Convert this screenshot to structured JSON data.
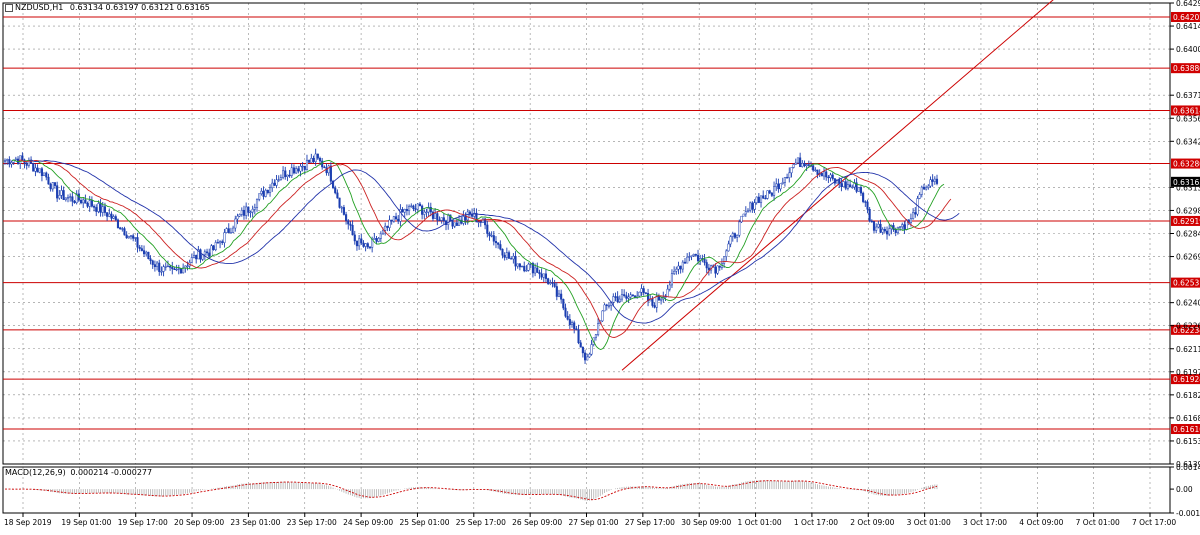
{
  "chart_header": {
    "symbol_info": "NZDUSD,H1",
    "ohlc": "0.63134 0.63197 0.63121 0.63165"
  },
  "macd_header": {
    "label": "MACD(12,26,9)",
    "values": "0.000214 -0.000277"
  },
  "colors": {
    "background": "#ffffff",
    "grid": "#000000",
    "candle": "#1a3db0",
    "level_line": "#cc0000",
    "level_label_bg": "#d00000",
    "current_price_bg": "#000000",
    "ma_fast": "#22a022",
    "ma_mid": "#cc2222",
    "ma_slow": "#2233aa",
    "trend_line": "#cc0000",
    "macd_hist": "#b0b0b0",
    "macd_signal": "#cc0000"
  },
  "chart_data": {
    "type": "candlestick",
    "symbol": "NZDUSD",
    "timeframe": "H1",
    "price_axis_ticks": [
      "0.64290",
      "0.64145",
      "0.64000",
      "0.63710",
      "0.63565",
      "0.63420",
      "0.63130",
      "0.62985",
      "0.62840",
      "0.62695",
      "0.62405",
      "0.62260",
      "0.62115",
      "0.61970",
      "0.61825",
      "0.61680",
      "0.61535",
      "0.61390"
    ],
    "price_range": [
      0.6139,
      0.6429
    ],
    "time_labels": [
      "18 Sep 2019",
      "19 Sep 01:00",
      "19 Sep 17:00",
      "20 Sep 09:00",
      "23 Sep 01:00",
      "23 Sep 17:00",
      "24 Sep 09:00",
      "25 Sep 01:00",
      "25 Sep 17:00",
      "26 Sep 09:00",
      "27 Sep 01:00",
      "27 Sep 17:00",
      "30 Sep 09:00",
      "1 Oct 01:00",
      "1 Oct 17:00",
      "2 Oct 09:00",
      "3 Oct 01:00",
      "3 Oct 17:00",
      "4 Oct 09:00",
      "7 Oct 01:00",
      "7 Oct 17:00"
    ],
    "horizontal_levels": [
      "0.64202",
      "0.63880",
      "0.63614",
      "0.63280",
      "0.62919",
      "0.62531",
      "0.62234",
      "0.61924",
      "0.61610"
    ],
    "current_price": "0.63165",
    "price_path": [
      0.633,
      0.6331,
      0.6327,
      0.6322,
      0.6309,
      0.6306,
      0.6305,
      0.6301,
      0.6296,
      0.6288,
      0.6279,
      0.6269,
      0.6262,
      0.6259,
      0.6265,
      0.6271,
      0.6273,
      0.6283,
      0.6294,
      0.6301,
      0.631,
      0.6319,
      0.6324,
      0.6327,
      0.6331,
      0.6324,
      0.63,
      0.628,
      0.6274,
      0.6282,
      0.6292,
      0.6299,
      0.63,
      0.6296,
      0.6293,
      0.6291,
      0.6296,
      0.629,
      0.6278,
      0.6268,
      0.6264,
      0.6262,
      0.6254,
      0.624,
      0.6223,
      0.6203,
      0.6232,
      0.6244,
      0.6243,
      0.6248,
      0.6239,
      0.6247,
      0.6263,
      0.6272,
      0.6266,
      0.6262,
      0.6278,
      0.6293,
      0.6306,
      0.6308,
      0.6318,
      0.6328,
      0.633,
      0.6322,
      0.6317,
      0.6314,
      0.6313,
      0.6289,
      0.6287,
      0.6288,
      0.6292,
      0.6314,
      0.6316
    ],
    "macd_axis_ticks": [
      "0.00147",
      "0.00",
      "-0.00159"
    ],
    "macd_range": [
      -0.00159,
      0.00147
    ]
  }
}
